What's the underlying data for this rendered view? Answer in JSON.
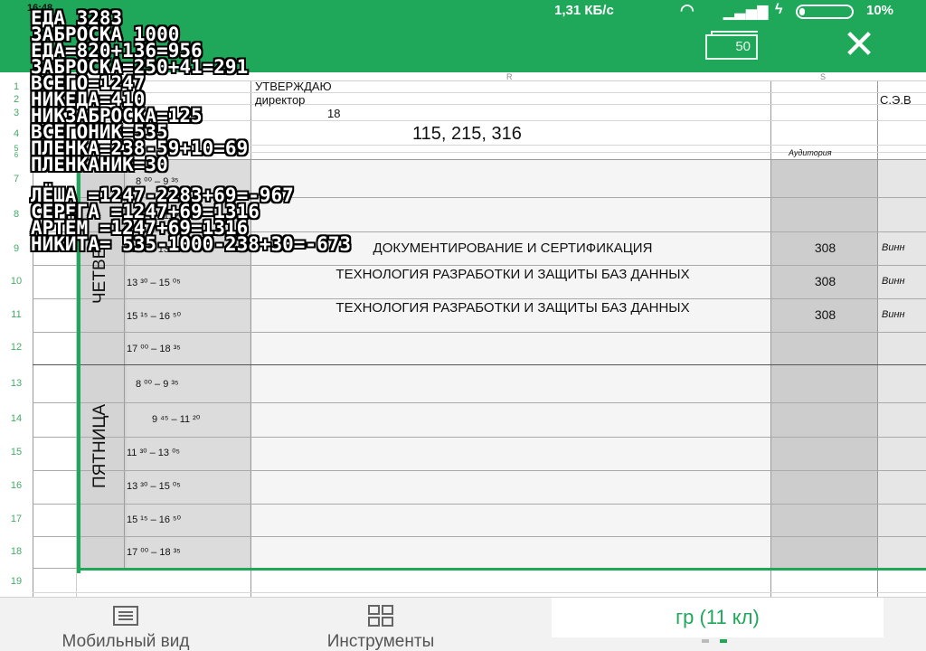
{
  "status": {
    "time": "16:48",
    "speed": "1,31 КБ/с",
    "battery": "10%"
  },
  "app": {
    "sheets_count": "50",
    "close_icon": "close-icon",
    "sheets_icon": "sheets-icon"
  },
  "columns": {
    "r": "R",
    "s": "S"
  },
  "rows": [
    "1",
    "2",
    "3",
    "4",
    "5",
    "6",
    "7",
    "8",
    "9",
    "10",
    "11",
    "12",
    "13",
    "14",
    "15",
    "16",
    "17",
    "18",
    "19"
  ],
  "header": {
    "approve": "УТВЕРЖДАЮ",
    "director": "директор",
    "year_tail": "18",
    "signatory": "С.Э.В",
    "groups": "115, 215, 316",
    "room_header": "Аудитория"
  },
  "thursday": {
    "day": "ЧЕТВЕ",
    "slots": [
      {
        "time": "8 ⁰⁰ – 9 ³⁵",
        "subject": "",
        "room": "",
        "teacher": ""
      },
      {
        "time": "9 ⁴⁵ – 11 ²⁰",
        "subject": "",
        "room": "",
        "teacher": ""
      },
      {
        "time": "11 ³⁰ – 13 ⁰⁵",
        "subject": "ДОКУМЕНТИРОВАНИЕ И СЕРТИФИКАЦИЯ",
        "room": "308",
        "teacher": "Винн"
      },
      {
        "time": "13 ³⁰ – 15 ⁰⁵",
        "subject": "ТЕХНОЛОГИЯ РАЗРАБОТКИ И ЗАЩИТЫ БАЗ ДАННЫХ",
        "room": "308",
        "teacher": "Винн"
      },
      {
        "time": "15 ¹⁵ – 16 ⁵⁰",
        "subject": "ТЕХНОЛОГИЯ РАЗРАБОТКИ И ЗАЩИТЫ БАЗ ДАННЫХ",
        "room": "308",
        "teacher": "Винн"
      },
      {
        "time": "17 ⁰⁰ – 18 ³⁵",
        "subject": "",
        "room": "",
        "teacher": ""
      }
    ]
  },
  "friday": {
    "day": "ПЯТНИЦА",
    "slots": [
      {
        "time": "8 ⁰⁰ – 9 ³⁵"
      },
      {
        "time": "9 ⁴⁵ – 11 ²⁰"
      },
      {
        "time": "11 ³⁰ – 13 ⁰⁵"
      },
      {
        "time": "13 ³⁰ – 15 ⁰⁵"
      },
      {
        "time": "15 ¹⁵ – 16 ⁵⁰"
      },
      {
        "time": "17 ⁰⁰ – 18 ³⁵"
      }
    ]
  },
  "notes": [
    "ЕДА 3283",
    "ЗАБРОСКА 1000",
    "ЕДА=820+136=956",
    "ЗАБРОСКА=250+41=291",
    "ВСЕГО=1247",
    "НИКЕДА=410",
    "НИКЗАБРОСКА=125",
    "ВСЕГОНИК=535",
    "ПЛЕНКА=238-59+10=69",
    "ПЛЕНКАНИК=30",
    "",
    "ЛЁША =1247-2283+69=-967",
    "СЕРЕГА =1247+69=1316",
    "АРТЁМ =1247+69=1316",
    "НИКИТА= 535-1000-238+30=-673"
  ],
  "bottom": {
    "mobile_view": "Мобильный вид",
    "tools": "Инструменты",
    "tab": "гр (11 кл)"
  }
}
